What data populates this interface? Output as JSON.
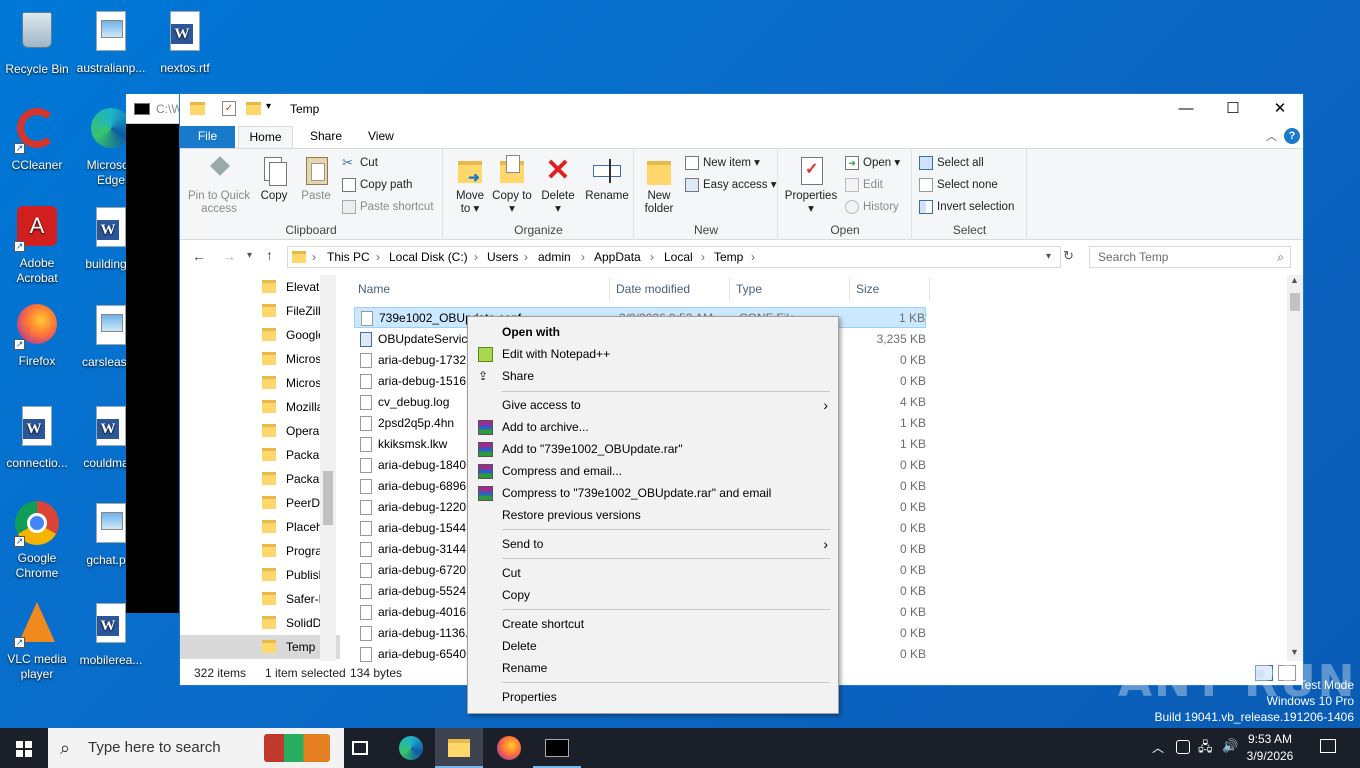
{
  "desktop": {
    "icons": [
      {
        "label": "Recycle Bin"
      },
      {
        "label": "australianp..."
      },
      {
        "label": "nextos.rtf"
      },
      {
        "label": "CCleaner"
      },
      {
        "label": "Microsoft Edge"
      },
      {
        "label": "Adobe Acrobat"
      },
      {
        "label": "building..."
      },
      {
        "label": "Firefox"
      },
      {
        "label": "carsleast..."
      },
      {
        "label": "connectio..."
      },
      {
        "label": "couldma..."
      },
      {
        "label": "Google Chrome"
      },
      {
        "label": "gchat.p..."
      },
      {
        "label": "VLC media player"
      },
      {
        "label": "mobilerea..."
      }
    ]
  },
  "cmd": {
    "title": "C:\\W"
  },
  "explorer": {
    "title": "Temp",
    "controls": {
      "minimize": "—",
      "maximize": "☐",
      "close": "✕"
    },
    "tabs": {
      "file": "File",
      "home": "Home",
      "share": "Share",
      "view": "View"
    },
    "ribbon": {
      "clipboard": {
        "label": "Clipboard",
        "pin": "Pin to Quick access",
        "copy": "Copy",
        "paste": "Paste",
        "cut": "Cut",
        "copy_path": "Copy path",
        "paste_shortcut": "Paste shortcut"
      },
      "organize": {
        "label": "Organize",
        "move_to": "Move to",
        "copy_to": "Copy to",
        "delete": "Delete",
        "rename": "Rename"
      },
      "new": {
        "label": "New",
        "new_folder": "New folder",
        "new_item": "New item",
        "easy_access": "Easy access"
      },
      "open": {
        "label": "Open",
        "properties": "Properties",
        "open": "Open",
        "edit": "Edit",
        "history": "History"
      },
      "select": {
        "label": "Select",
        "select_all": "Select all",
        "select_none": "Select none",
        "invert": "Invert selection"
      }
    },
    "address": {
      "crumbs": [
        "This PC",
        "Local Disk (C:)",
        "Users",
        "admin",
        "AppData",
        "Local",
        "Temp"
      ],
      "search_placeholder": "Search Temp"
    },
    "nav_items": [
      "Elevate",
      "FileZilla",
      "Google",
      "Microso",
      "Microso",
      "Mozilla",
      "Opera",
      "Packag",
      "Packag",
      "PeerDis",
      "Placeho",
      "Program",
      "Publish",
      "Safer-N",
      "SolidDo",
      "Temp"
    ],
    "columns": {
      "name": "Name",
      "date": "Date modified",
      "type": "Type",
      "size": "Size"
    },
    "files": [
      {
        "name": "739e1002_OBUpdate.conf",
        "date": "3/9/2026 9:53 AM",
        "type": "CONF File",
        "size": "1 KB"
      },
      {
        "name": "OBUpdateService",
        "size": "3,235 KB"
      },
      {
        "name": "aria-debug-1732.",
        "size": "0 KB"
      },
      {
        "name": "aria-debug-1516.",
        "size": "0 KB"
      },
      {
        "name": "cv_debug.log",
        "size": "4 KB"
      },
      {
        "name": "2psd2q5p.4hn",
        "size": "1 KB"
      },
      {
        "name": "kkiksmsk.lkw",
        "size": "1 KB"
      },
      {
        "name": "aria-debug-1840.",
        "size": "0 KB"
      },
      {
        "name": "aria-debug-6896.",
        "size": "0 KB"
      },
      {
        "name": "aria-debug-1220.",
        "size": "0 KB"
      },
      {
        "name": "aria-debug-1544.",
        "size": "0 KB"
      },
      {
        "name": "aria-debug-3144.",
        "size": "0 KB"
      },
      {
        "name": "aria-debug-6720.",
        "size": "0 KB"
      },
      {
        "name": "aria-debug-5524.",
        "size": "0 KB"
      },
      {
        "name": "aria-debug-4016.",
        "size": "0 KB"
      },
      {
        "name": "aria-debug-1136.",
        "size": "0 KB"
      },
      {
        "name": "aria-debug-6540.",
        "size": "0 KB"
      }
    ],
    "status": {
      "count": "322 items",
      "selected": "1 item selected",
      "bytes": "134 bytes"
    }
  },
  "context_menu": {
    "items": [
      "Open with",
      "Edit with Notepad++",
      "Share",
      "Give access to",
      "Add to archive...",
      "Add to \"739e1002_OBUpdate.rar\"",
      "Compress and email...",
      "Compress to \"739e1002_OBUpdate.rar\" and email",
      "Restore previous versions",
      "Send to",
      "Cut",
      "Copy",
      "Create shortcut",
      "Delete",
      "Rename",
      "Properties"
    ]
  },
  "taskbar": {
    "search_placeholder": "Type here to search",
    "time": "9:53 AM",
    "date": "3/9/2026"
  },
  "watermark": {
    "line1": "Test Mode",
    "line2": "Windows 10 Pro",
    "line3": "Build 19041.vb_release.191206-1406",
    "brand": "ANY RUN"
  }
}
